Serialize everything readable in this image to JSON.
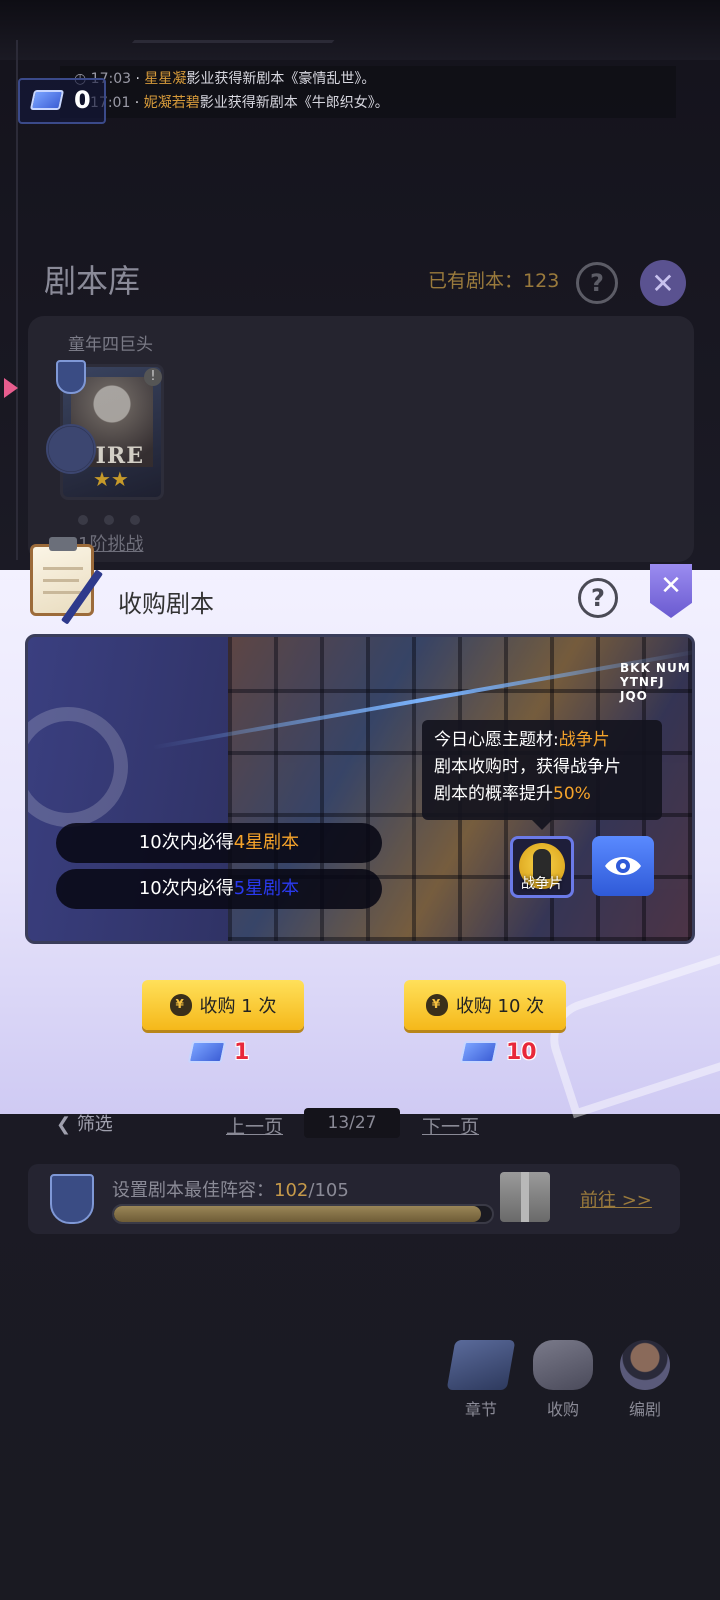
{
  "ticker": {
    "rows": [
      {
        "time": "17:03",
        "studio": "星星凝",
        "text": "影业获得新剧本《豪情乱世》。"
      },
      {
        "time": "17:01",
        "studio": "妮凝若碧",
        "text": "影业获得新剧本《牛郎织女》。"
      }
    ],
    "ticket_count": "0"
  },
  "library": {
    "title": "剧本库",
    "owned_label": "已有剧本：",
    "owned_count": "123",
    "help_icon": "question-icon",
    "close_icon": "close-icon",
    "group_label": "童年四巨头",
    "card_text": "FIRE",
    "card_stars": "★★",
    "card_info": "!",
    "challenge_label": "1阶挑战"
  },
  "popup": {
    "title": "收购剧本",
    "help_icon": "question-icon",
    "close_icon": "close-icon",
    "poster_caption": "BKK NUM YTNFJ JQO",
    "guarantee_1_prefix": "10次内必得",
    "guarantee_1_highlight": "4星剧本",
    "guarantee_2_prefix": "10次内必得",
    "guarantee_2_highlight": "5星剧本",
    "tooltip": {
      "line1_prefix": "今日心愿主题材:",
      "line1_genre": "战争片",
      "line2": "剧本收购时，获得战争片",
      "line3_prefix": "剧本的概率提升",
      "line3_percent": "50%"
    },
    "genre_label": "战争片",
    "buy_once_label": "收购 1 次",
    "buy_ten_label": "收购 10 次",
    "cost_once": "1",
    "cost_ten": "10",
    "colors": {
      "gold": "#f5a32a",
      "blue": "#2a3af0",
      "cost_red": "#e8283a"
    }
  },
  "pager": {
    "filter_label": "筛选",
    "prev_label": "上一页",
    "page": "13/27",
    "next_label": "下一页"
  },
  "lineup": {
    "label": "设置剧本最佳阵容：",
    "current": "102",
    "separator": "/",
    "total": "105",
    "progress": 0.971,
    "goto_label": "前往 >>"
  },
  "nav": {
    "chapter": "章节",
    "buy": "收购",
    "writer": "编剧"
  }
}
